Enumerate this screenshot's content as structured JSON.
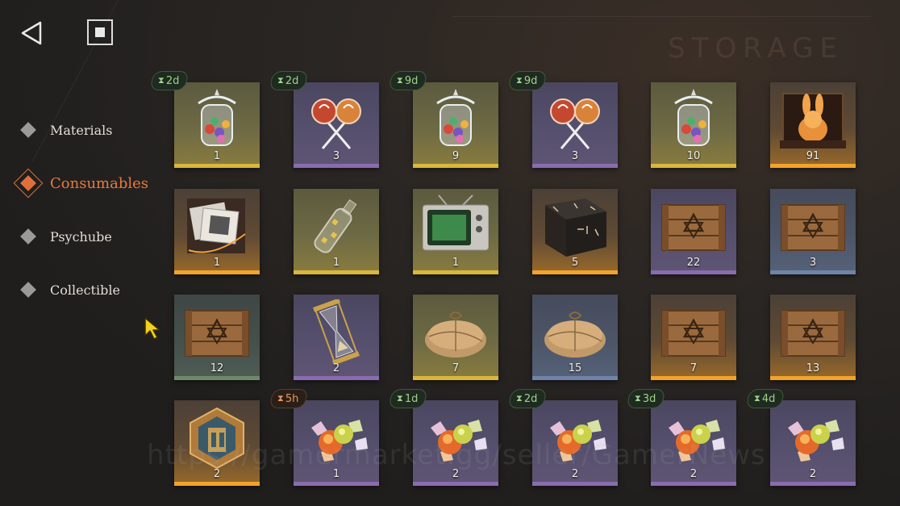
{
  "header": {
    "back_icon": "back-triangle-icon",
    "home_icon": "stop-square-icon",
    "storage_title": "STORAGE"
  },
  "sidebar": {
    "items": [
      {
        "label": "Materials",
        "active": false
      },
      {
        "label": "Consumables",
        "active": true
      },
      {
        "label": "Psychube",
        "active": false
      },
      {
        "label": "Collectible",
        "active": false
      }
    ]
  },
  "colors": {
    "accent": "#e0703a",
    "timer_text": "#9fd08a",
    "timer_warn_text": "#e9945a",
    "rarity_gold": "#d9b73b",
    "rarity_orange": "#f2a32a",
    "rarity_purple": "#8a6cb0",
    "rarity_blue": "#6e84a8",
    "rarity_green": "#6e8a6a"
  },
  "inventory": {
    "rows": [
      [
        {
          "item": "candy-jar",
          "qty": "1",
          "rarity": "gold",
          "timer": "2d"
        },
        {
          "item": "lollipops",
          "qty": "3",
          "rarity": "purple",
          "timer": "2d"
        },
        {
          "item": "candy-jar",
          "qty": "9",
          "rarity": "gold",
          "timer": "9d"
        },
        {
          "item": "lollipops",
          "qty": "3",
          "rarity": "purple",
          "timer": "9d"
        },
        {
          "item": "candy-jar",
          "qty": "10",
          "rarity": "gold",
          "timer": ""
        },
        {
          "item": "golden-rabbit-box",
          "qty": "91",
          "rarity": "orange",
          "timer": ""
        }
      ],
      [
        {
          "item": "photo-album-box",
          "qty": "1",
          "rarity": "orange",
          "timer": ""
        },
        {
          "item": "message-bottle",
          "qty": "1",
          "rarity": "gold",
          "timer": ""
        },
        {
          "item": "retro-tv",
          "qty": "1",
          "rarity": "gold",
          "timer": ""
        },
        {
          "item": "rune-crate",
          "qty": "5",
          "rarity": "orange",
          "timer": ""
        },
        {
          "item": "wooden-crate",
          "qty": "22",
          "rarity": "purple",
          "timer": ""
        },
        {
          "item": "wooden-crate",
          "qty": "3",
          "rarity": "blue",
          "timer": ""
        }
      ],
      [
        {
          "item": "wooden-crate",
          "qty": "12",
          "rarity": "green",
          "timer": ""
        },
        {
          "item": "hourglass",
          "qty": "2",
          "rarity": "purple",
          "timer": ""
        },
        {
          "item": "parcel",
          "qty": "7",
          "rarity": "gold",
          "timer": ""
        },
        {
          "item": "parcel",
          "qty": "15",
          "rarity": "blue",
          "timer": ""
        },
        {
          "item": "wooden-crate",
          "qty": "7",
          "rarity": "orange",
          "timer": ""
        },
        {
          "item": "wooden-crate",
          "qty": "13",
          "rarity": "orange",
          "timer": ""
        }
      ],
      [
        {
          "item": "hex-badge",
          "qty": "2",
          "rarity": "orange",
          "timer": ""
        },
        {
          "item": "candies",
          "qty": "1",
          "rarity": "purple",
          "timer": "5h"
        },
        {
          "item": "candies",
          "qty": "2",
          "rarity": "purple",
          "timer": "1d"
        },
        {
          "item": "candies",
          "qty": "2",
          "rarity": "purple",
          "timer": "2d"
        },
        {
          "item": "candies",
          "qty": "2",
          "rarity": "purple",
          "timer": "3d"
        },
        {
          "item": "candies",
          "qty": "2",
          "rarity": "purple",
          "timer": "4d"
        }
      ]
    ]
  },
  "watermark": "https://gamermarket.gg/seller/GamerNews"
}
